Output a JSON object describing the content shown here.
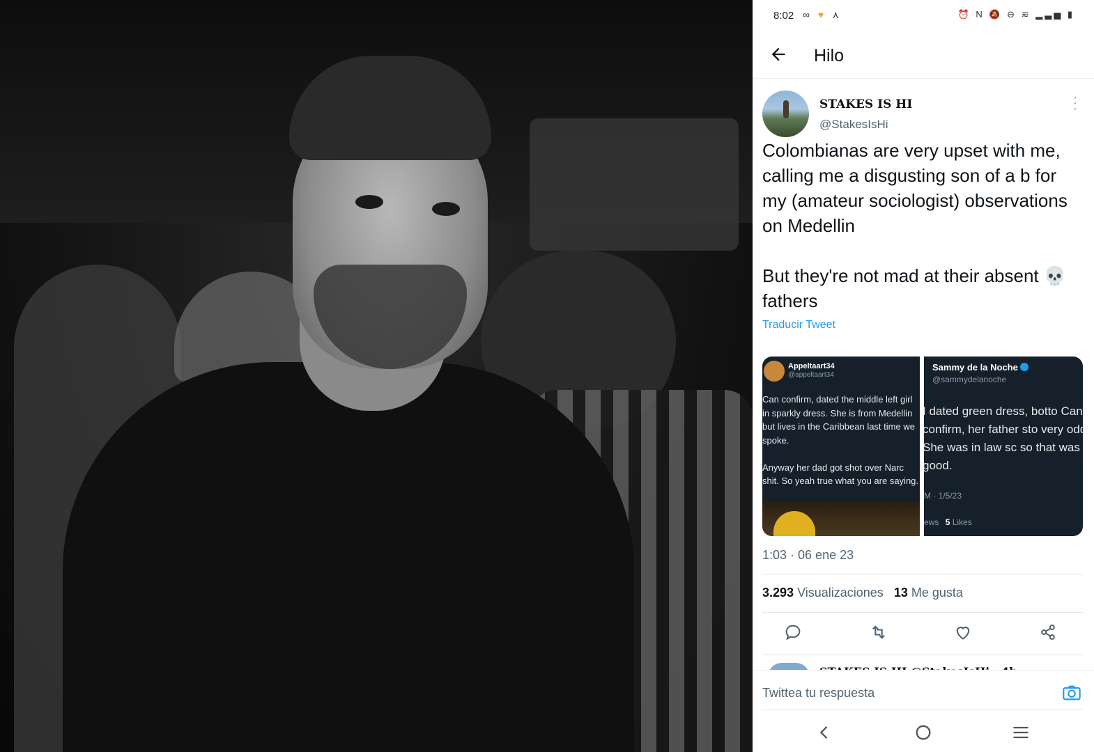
{
  "status_bar": {
    "time": "8:02",
    "left_icons": [
      "link-icon",
      "heart-icon",
      "person-icon"
    ],
    "right_icons": [
      "alarm-icon",
      "nfc-icon",
      "mute-icon",
      "dnd-icon",
      "volte-icon",
      "wifi-icon",
      "signal-icon",
      "battery-icon"
    ]
  },
  "header": {
    "back_icon": "arrow-left-icon",
    "title": "Hilo"
  },
  "tweet": {
    "author_name": "STAKES IS HI",
    "author_handle": "@StakesIsHi",
    "text": "Colombianas are very upset with me, calling me a disgusting son of a b for my (amateur sociologist) observations on Medellin\n\nBut they're not mad at their absent 💀 fathers",
    "translate_link": "Traducir Tweet",
    "timestamp": "1:03 · 06 ene 23",
    "views_count": "3.293",
    "views_label": "Visualizaciones",
    "likes_count": "13",
    "likes_label": "Me gusta"
  },
  "media": {
    "left": {
      "name": "Appeltaart34",
      "handle": "@appeltaart34",
      "text": "Can confirm, dated the middle left girl in sparkly dress. She is from Medellin but lives in the Caribbean last time we spoke.\n\nAnyway her dad got shot over Narc shit. So yeah true what you are saying."
    },
    "right": {
      "name": "Sammy de la Noche",
      "handle": "@sammydelanoche",
      "text": "I dated green dress, botto Can confirm, her father sto very odd. She was in law sc so that was good.",
      "time": "M · 1/5/23",
      "views_fragment": "ews",
      "likes_count": "5",
      "likes_label": "Likes"
    }
  },
  "next_tweet_preview": "STAKES IS HI @StakesIsHi · 4h",
  "reply": {
    "placeholder": "Twittea tu respuesta"
  },
  "nav": [
    "back-nav-icon",
    "home-nav-icon",
    "recents-nav-icon"
  ]
}
